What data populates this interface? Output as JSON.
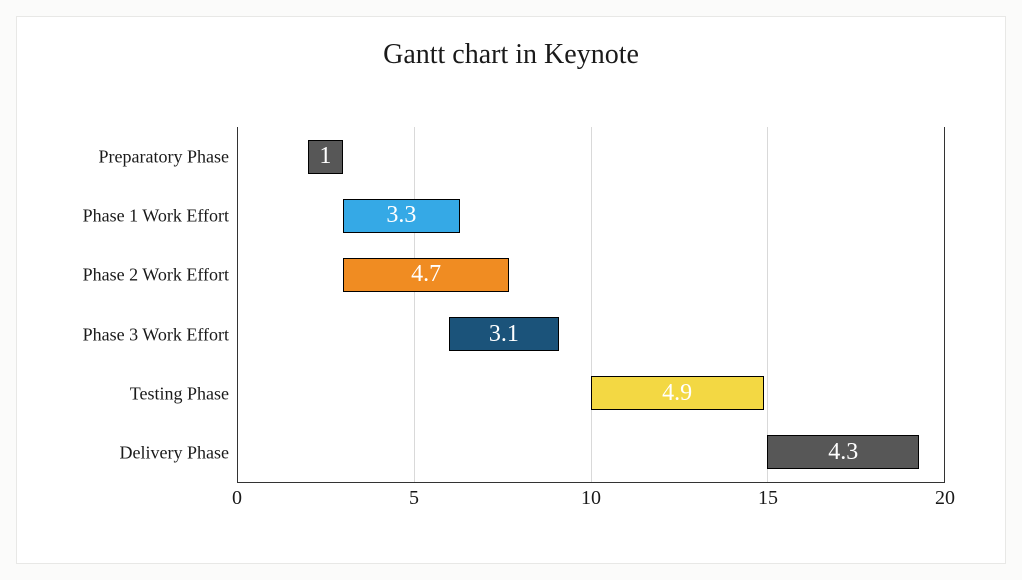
{
  "chart_data": {
    "type": "bar",
    "orientation": "horizontal-gantt",
    "title": "Gantt chart in Keynote",
    "xlabel": "",
    "ylabel": "",
    "xlim": [
      0,
      20
    ],
    "xticks": [
      0,
      5,
      10,
      15,
      20
    ],
    "categories": [
      "Preparatory Phase",
      "Phase 1 Work Effort",
      "Phase 2 Work Effort",
      "Phase 3 Work Effort",
      "Testing Phase",
      "Delivery Phase"
    ],
    "bars": [
      {
        "label": "Preparatory Phase",
        "start": 2.0,
        "duration": 1.0,
        "value_label": "1",
        "color": "#575757"
      },
      {
        "label": "Phase 1 Work Effort",
        "start": 3.0,
        "duration": 3.3,
        "value_label": "3.3",
        "color": "#35a9e6"
      },
      {
        "label": "Phase 2 Work Effort",
        "start": 3.0,
        "duration": 4.7,
        "value_label": "4.7",
        "color": "#f08c22"
      },
      {
        "label": "Phase 3 Work Effort",
        "start": 6.0,
        "duration": 3.1,
        "value_label": "3.1",
        "color": "#1b537a"
      },
      {
        "label": "Testing Phase",
        "start": 10.0,
        "duration": 4.9,
        "value_label": "4.9",
        "color": "#f3d843"
      },
      {
        "label": "Delivery Phase",
        "start": 15.0,
        "duration": 4.3,
        "value_label": "4.3",
        "color": "#575757"
      }
    ]
  }
}
